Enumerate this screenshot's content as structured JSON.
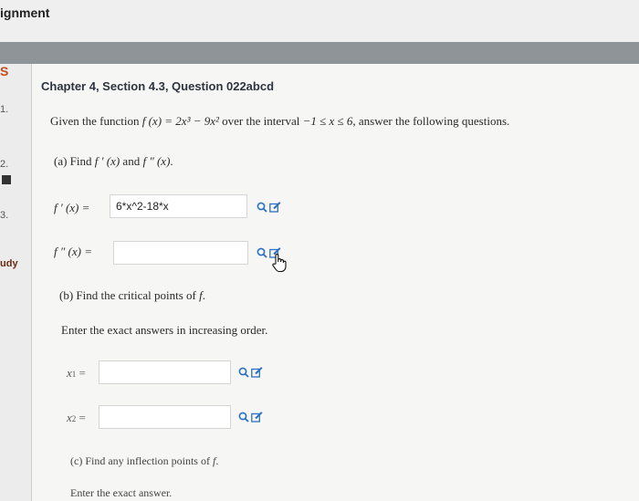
{
  "header": {
    "title": "ignment"
  },
  "leftnav": {
    "top_label": "S",
    "items": [
      "1.",
      "2.",
      "3."
    ],
    "bottom_label": "udy"
  },
  "chapter": "Chapter 4, Section 4.3, Question 022abcd",
  "intro": {
    "before": "Given the function ",
    "function": "f (x) = 2x³ − 9x²",
    "middle": " over the interval ",
    "interval": "−1 ≤ x ≤ 6",
    "after": ", answer the following questions."
  },
  "part_a": {
    "prompt_before": "(a) Find ",
    "fprime": "f ′ (x)",
    "and": " and ",
    "fdouble": "f ″ (x)",
    "period": ".",
    "label_fprime": "f ′ (x) =",
    "value_fprime": "6*x^2-18*x",
    "label_fdouble": "f ″ (x) =",
    "value_fdouble": ""
  },
  "part_b": {
    "prompt_before": "(b) Find the critical points of ",
    "f": "f",
    "period": ".",
    "instruction": "Enter the exact answers in increasing order.",
    "x1_label": "x",
    "x1_sub": "1",
    "x2_label": "x",
    "x2_sub": "2",
    "eq": "=",
    "x1_value": "",
    "x2_value": ""
  },
  "part_c": {
    "prompt_before": "(c) Find any inflection points of ",
    "f": "f",
    "period": ".",
    "instruction": "Enter the exact answer."
  },
  "icons": {
    "search": "search-icon",
    "edit": "edit-icon",
    "cursor": "hand-cursor-icon"
  },
  "colors": {
    "icon_blue": "#2a6fc0",
    "chapter": "#2c3440",
    "nav_accent": "#c64a1d"
  }
}
